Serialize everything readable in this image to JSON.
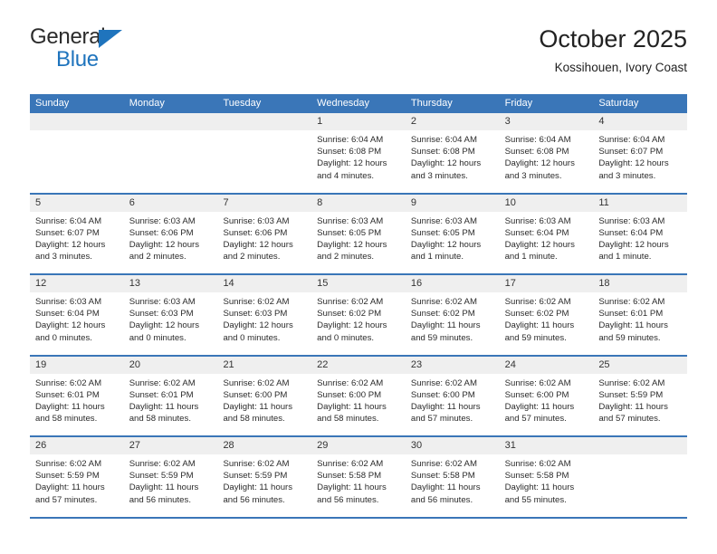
{
  "brand": {
    "name_top": "General",
    "name_bottom": "Blue",
    "accent_color": "#1f74bd"
  },
  "header": {
    "title": "October 2025",
    "subtitle": "Kossihouen, Ivory Coast"
  },
  "theme": {
    "header_blue": "#3a76b8",
    "day_band_gray": "#efefef",
    "text_color": "#2b2b2b"
  },
  "weekdays": [
    "Sunday",
    "Monday",
    "Tuesday",
    "Wednesday",
    "Thursday",
    "Friday",
    "Saturday"
  ],
  "labels": {
    "sunrise_prefix": "Sunrise:",
    "sunset_prefix": "Sunset:",
    "daylight_prefix": "Daylight:"
  },
  "weeks": [
    [
      {
        "day": "",
        "sunrise": "",
        "sunset": "",
        "daylight_line1": "",
        "daylight_line2": ""
      },
      {
        "day": "",
        "sunrise": "",
        "sunset": "",
        "daylight_line1": "",
        "daylight_line2": ""
      },
      {
        "day": "",
        "sunrise": "",
        "sunset": "",
        "daylight_line1": "",
        "daylight_line2": ""
      },
      {
        "day": "1",
        "sunrise": "Sunrise: 6:04 AM",
        "sunset": "Sunset: 6:08 PM",
        "daylight_line1": "Daylight: 12 hours",
        "daylight_line2": "and 4 minutes."
      },
      {
        "day": "2",
        "sunrise": "Sunrise: 6:04 AM",
        "sunset": "Sunset: 6:08 PM",
        "daylight_line1": "Daylight: 12 hours",
        "daylight_line2": "and 3 minutes."
      },
      {
        "day": "3",
        "sunrise": "Sunrise: 6:04 AM",
        "sunset": "Sunset: 6:08 PM",
        "daylight_line1": "Daylight: 12 hours",
        "daylight_line2": "and 3 minutes."
      },
      {
        "day": "4",
        "sunrise": "Sunrise: 6:04 AM",
        "sunset": "Sunset: 6:07 PM",
        "daylight_line1": "Daylight: 12 hours",
        "daylight_line2": "and 3 minutes."
      }
    ],
    [
      {
        "day": "5",
        "sunrise": "Sunrise: 6:04 AM",
        "sunset": "Sunset: 6:07 PM",
        "daylight_line1": "Daylight: 12 hours",
        "daylight_line2": "and 3 minutes."
      },
      {
        "day": "6",
        "sunrise": "Sunrise: 6:03 AM",
        "sunset": "Sunset: 6:06 PM",
        "daylight_line1": "Daylight: 12 hours",
        "daylight_line2": "and 2 minutes."
      },
      {
        "day": "7",
        "sunrise": "Sunrise: 6:03 AM",
        "sunset": "Sunset: 6:06 PM",
        "daylight_line1": "Daylight: 12 hours",
        "daylight_line2": "and 2 minutes."
      },
      {
        "day": "8",
        "sunrise": "Sunrise: 6:03 AM",
        "sunset": "Sunset: 6:05 PM",
        "daylight_line1": "Daylight: 12 hours",
        "daylight_line2": "and 2 minutes."
      },
      {
        "day": "9",
        "sunrise": "Sunrise: 6:03 AM",
        "sunset": "Sunset: 6:05 PM",
        "daylight_line1": "Daylight: 12 hours",
        "daylight_line2": "and 1 minute."
      },
      {
        "day": "10",
        "sunrise": "Sunrise: 6:03 AM",
        "sunset": "Sunset: 6:04 PM",
        "daylight_line1": "Daylight: 12 hours",
        "daylight_line2": "and 1 minute."
      },
      {
        "day": "11",
        "sunrise": "Sunrise: 6:03 AM",
        "sunset": "Sunset: 6:04 PM",
        "daylight_line1": "Daylight: 12 hours",
        "daylight_line2": "and 1 minute."
      }
    ],
    [
      {
        "day": "12",
        "sunrise": "Sunrise: 6:03 AM",
        "sunset": "Sunset: 6:04 PM",
        "daylight_line1": "Daylight: 12 hours",
        "daylight_line2": "and 0 minutes."
      },
      {
        "day": "13",
        "sunrise": "Sunrise: 6:03 AM",
        "sunset": "Sunset: 6:03 PM",
        "daylight_line1": "Daylight: 12 hours",
        "daylight_line2": "and 0 minutes."
      },
      {
        "day": "14",
        "sunrise": "Sunrise: 6:02 AM",
        "sunset": "Sunset: 6:03 PM",
        "daylight_line1": "Daylight: 12 hours",
        "daylight_line2": "and 0 minutes."
      },
      {
        "day": "15",
        "sunrise": "Sunrise: 6:02 AM",
        "sunset": "Sunset: 6:02 PM",
        "daylight_line1": "Daylight: 12 hours",
        "daylight_line2": "and 0 minutes."
      },
      {
        "day": "16",
        "sunrise": "Sunrise: 6:02 AM",
        "sunset": "Sunset: 6:02 PM",
        "daylight_line1": "Daylight: 11 hours",
        "daylight_line2": "and 59 minutes."
      },
      {
        "day": "17",
        "sunrise": "Sunrise: 6:02 AM",
        "sunset": "Sunset: 6:02 PM",
        "daylight_line1": "Daylight: 11 hours",
        "daylight_line2": "and 59 minutes."
      },
      {
        "day": "18",
        "sunrise": "Sunrise: 6:02 AM",
        "sunset": "Sunset: 6:01 PM",
        "daylight_line1": "Daylight: 11 hours",
        "daylight_line2": "and 59 minutes."
      }
    ],
    [
      {
        "day": "19",
        "sunrise": "Sunrise: 6:02 AM",
        "sunset": "Sunset: 6:01 PM",
        "daylight_line1": "Daylight: 11 hours",
        "daylight_line2": "and 58 minutes."
      },
      {
        "day": "20",
        "sunrise": "Sunrise: 6:02 AM",
        "sunset": "Sunset: 6:01 PM",
        "daylight_line1": "Daylight: 11 hours",
        "daylight_line2": "and 58 minutes."
      },
      {
        "day": "21",
        "sunrise": "Sunrise: 6:02 AM",
        "sunset": "Sunset: 6:00 PM",
        "daylight_line1": "Daylight: 11 hours",
        "daylight_line2": "and 58 minutes."
      },
      {
        "day": "22",
        "sunrise": "Sunrise: 6:02 AM",
        "sunset": "Sunset: 6:00 PM",
        "daylight_line1": "Daylight: 11 hours",
        "daylight_line2": "and 58 minutes."
      },
      {
        "day": "23",
        "sunrise": "Sunrise: 6:02 AM",
        "sunset": "Sunset: 6:00 PM",
        "daylight_line1": "Daylight: 11 hours",
        "daylight_line2": "and 57 minutes."
      },
      {
        "day": "24",
        "sunrise": "Sunrise: 6:02 AM",
        "sunset": "Sunset: 6:00 PM",
        "daylight_line1": "Daylight: 11 hours",
        "daylight_line2": "and 57 minutes."
      },
      {
        "day": "25",
        "sunrise": "Sunrise: 6:02 AM",
        "sunset": "Sunset: 5:59 PM",
        "daylight_line1": "Daylight: 11 hours",
        "daylight_line2": "and 57 minutes."
      }
    ],
    [
      {
        "day": "26",
        "sunrise": "Sunrise: 6:02 AM",
        "sunset": "Sunset: 5:59 PM",
        "daylight_line1": "Daylight: 11 hours",
        "daylight_line2": "and 57 minutes."
      },
      {
        "day": "27",
        "sunrise": "Sunrise: 6:02 AM",
        "sunset": "Sunset: 5:59 PM",
        "daylight_line1": "Daylight: 11 hours",
        "daylight_line2": "and 56 minutes."
      },
      {
        "day": "28",
        "sunrise": "Sunrise: 6:02 AM",
        "sunset": "Sunset: 5:59 PM",
        "daylight_line1": "Daylight: 11 hours",
        "daylight_line2": "and 56 minutes."
      },
      {
        "day": "29",
        "sunrise": "Sunrise: 6:02 AM",
        "sunset": "Sunset: 5:58 PM",
        "daylight_line1": "Daylight: 11 hours",
        "daylight_line2": "and 56 minutes."
      },
      {
        "day": "30",
        "sunrise": "Sunrise: 6:02 AM",
        "sunset": "Sunset: 5:58 PM",
        "daylight_line1": "Daylight: 11 hours",
        "daylight_line2": "and 56 minutes."
      },
      {
        "day": "31",
        "sunrise": "Sunrise: 6:02 AM",
        "sunset": "Sunset: 5:58 PM",
        "daylight_line1": "Daylight: 11 hours",
        "daylight_line2": "and 55 minutes."
      },
      {
        "day": "",
        "sunrise": "",
        "sunset": "",
        "daylight_line1": "",
        "daylight_line2": ""
      }
    ]
  ]
}
